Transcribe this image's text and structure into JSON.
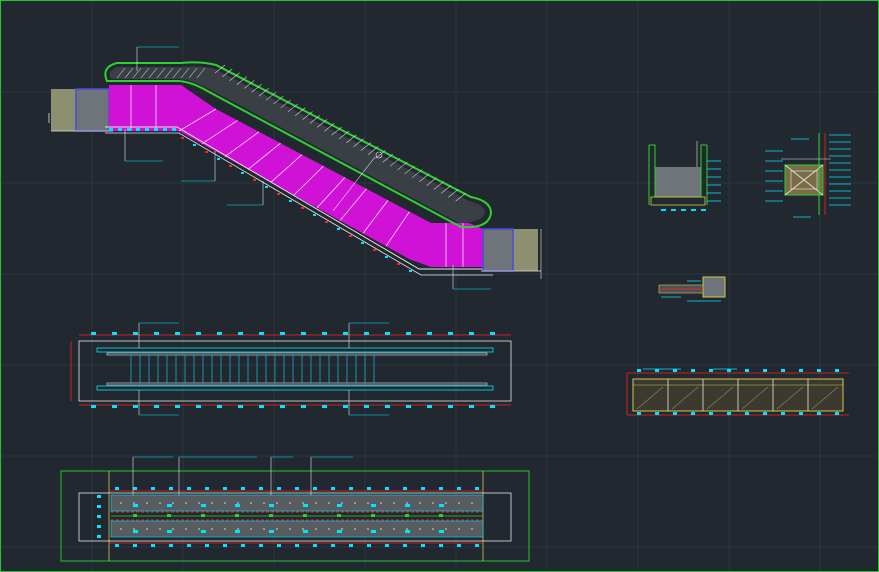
{
  "colors": {
    "background": "#212830",
    "grid": "#2c3440",
    "frame": "#22c32b",
    "handrail": "#2fd12f",
    "glass": "#d011d6",
    "dimension": "#ff2020",
    "annotation": "#00e5ff",
    "structure": "#4a4ad8",
    "concrete": "#7a7f86",
    "yellow": "#d8c64a",
    "white": "#e6e6e6"
  },
  "drawing": {
    "elevation_label": "",
    "plan_label": "",
    "section_label": ""
  }
}
